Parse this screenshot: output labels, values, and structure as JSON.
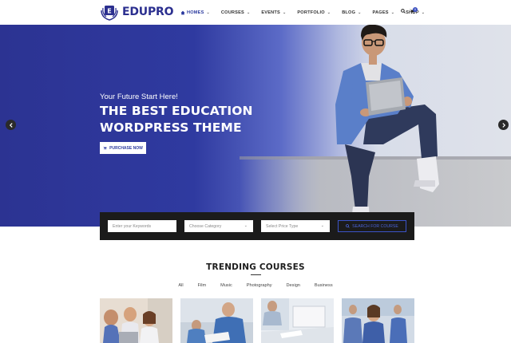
{
  "brand": {
    "name": "EDUPRO",
    "badge_letter": "E"
  },
  "nav": {
    "items": [
      {
        "label": "HOMES",
        "active": true
      },
      {
        "label": "COURSES"
      },
      {
        "label": "EVENTS"
      },
      {
        "label": "PORTFOLIO"
      },
      {
        "label": "BLOG"
      },
      {
        "label": "PAGES"
      },
      {
        "label": "SHOP"
      }
    ],
    "cart_count": "0"
  },
  "hero": {
    "subtitle": "Your Future Start Here!",
    "title_line1": "THE BEST EDUCATION",
    "title_line2": "WORDPRESS THEME",
    "button_label": "PURCHASE NOW"
  },
  "search": {
    "keywords_placeholder": "Enter your Keywords",
    "category_placeholder": "Choose Category",
    "price_placeholder": "Select Price Type",
    "button_label": "SEARCH FOR COURSE"
  },
  "trending": {
    "title": "TRENDING COURSES",
    "filters": [
      "All",
      "Film",
      "Music",
      "Photography",
      "Design",
      "Business"
    ]
  },
  "colors": {
    "brand": "#2b3a9e",
    "hero_blue": "#2f3aa0",
    "search_bg": "#1b1b1b",
    "accent": "#3b53c7"
  }
}
